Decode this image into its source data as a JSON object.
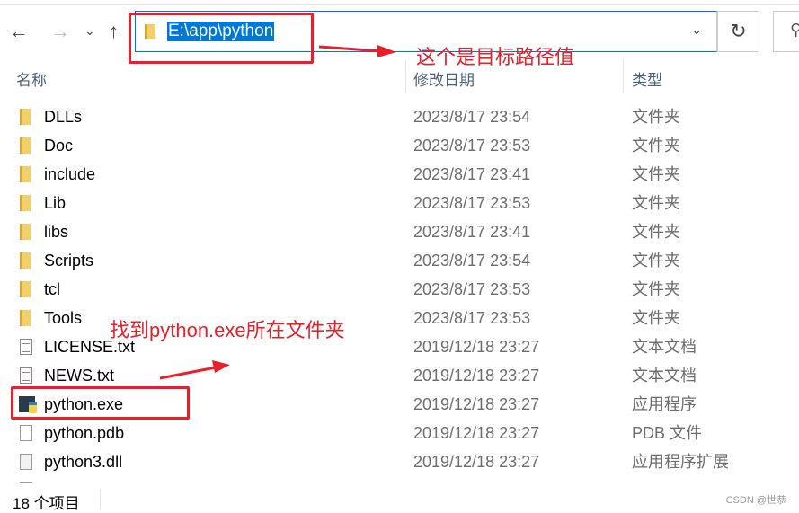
{
  "nav": {
    "back": "←",
    "forward": "→",
    "recent": "⌄",
    "up": "↑"
  },
  "address": {
    "path": "E:\\app\\python",
    "dropdown": "⌄"
  },
  "refresh": "↻",
  "search_icon": "⚲",
  "columns": {
    "name": "名称",
    "date": "修改日期",
    "type": "类型"
  },
  "files": [
    {
      "name": "DLLs",
      "date": "2023/8/17 23:54",
      "type": "文件夹",
      "icon": "folder"
    },
    {
      "name": "Doc",
      "date": "2023/8/17 23:53",
      "type": "文件夹",
      "icon": "folder"
    },
    {
      "name": "include",
      "date": "2023/8/17 23:41",
      "type": "文件夹",
      "icon": "folder"
    },
    {
      "name": "Lib",
      "date": "2023/8/17 23:53",
      "type": "文件夹",
      "icon": "folder"
    },
    {
      "name": "libs",
      "date": "2023/8/17 23:41",
      "type": "文件夹",
      "icon": "folder"
    },
    {
      "name": "Scripts",
      "date": "2023/8/17 23:54",
      "type": "文件夹",
      "icon": "folder"
    },
    {
      "name": "tcl",
      "date": "2023/8/17 23:53",
      "type": "文件夹",
      "icon": "folder"
    },
    {
      "name": "Tools",
      "date": "2023/8/17 23:53",
      "type": "文件夹",
      "icon": "folder"
    },
    {
      "name": "LICENSE.txt",
      "date": "2019/12/18 23:27",
      "type": "文本文档",
      "icon": "txt"
    },
    {
      "name": "NEWS.txt",
      "date": "2019/12/18 23:27",
      "type": "文本文档",
      "icon": "txt"
    },
    {
      "name": "python.exe",
      "date": "2019/12/18 23:27",
      "type": "应用程序",
      "icon": "exe"
    },
    {
      "name": "python.pdb",
      "date": "2019/12/18 23:27",
      "type": "PDB 文件",
      "icon": "file"
    },
    {
      "name": "python3.dll",
      "date": "2019/12/18 23:27",
      "type": "应用程序扩展",
      "icon": "dll"
    }
  ],
  "status": "18 个项目",
  "watermark": "CSDN @世恭",
  "annotations": {
    "path_note": "这个是目标路径值",
    "exe_note": "找到python.exe所在文件夹",
    "color": "#e8202a"
  }
}
